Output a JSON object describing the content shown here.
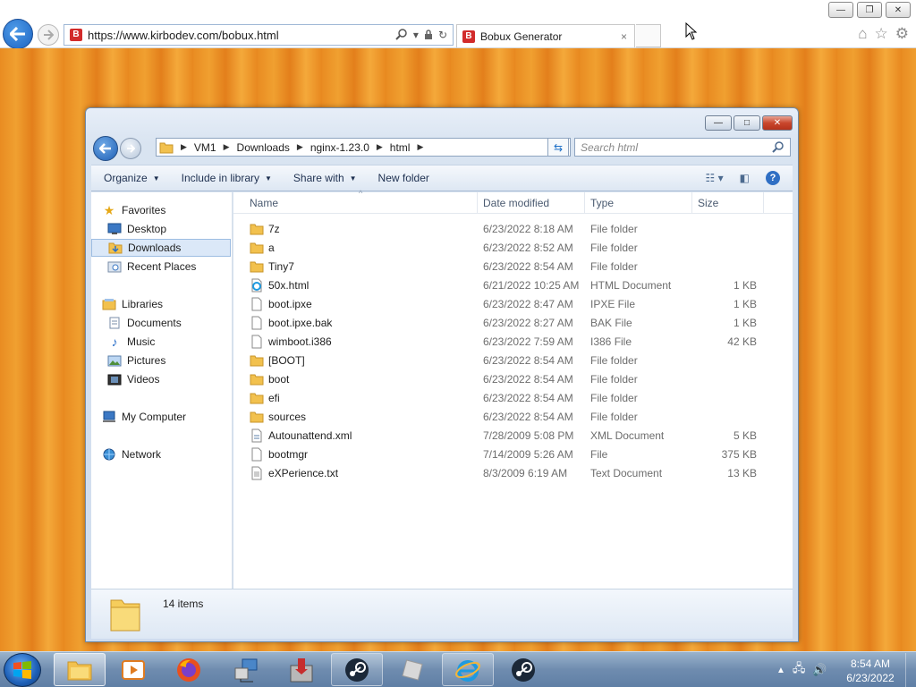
{
  "browser": {
    "url": "https://www.kirbodev.com/bobux.html",
    "tab_title": "Bobux Generator",
    "tab_close": "×",
    "site_badge": "B",
    "colors": {
      "badge": "#d22b2b",
      "back": "#1c64c2"
    }
  },
  "explorer": {
    "breadcrumb": [
      "VM1",
      "Downloads",
      "nginx-1.23.0",
      "html"
    ],
    "search_placeholder": "Search html",
    "commands": [
      "Organize",
      "Include in library",
      "Share with",
      "New folder"
    ],
    "nav": {
      "favorites": "Favorites",
      "fav_items": [
        "Desktop",
        "Downloads",
        "Recent Places"
      ],
      "libraries": "Libraries",
      "lib_items": [
        "Documents",
        "Music",
        "Pictures",
        "Videos"
      ],
      "computer": "My Computer",
      "network": "Network"
    },
    "columns": {
      "name": "Name",
      "date": "Date modified",
      "type": "Type",
      "size": "Size"
    },
    "files": [
      {
        "name": "7z",
        "date": "6/23/2022 8:18 AM",
        "type": "File folder",
        "size": "",
        "icon": "folder"
      },
      {
        "name": "a",
        "date": "6/23/2022 8:52 AM",
        "type": "File folder",
        "size": "",
        "icon": "folder"
      },
      {
        "name": "Tiny7",
        "date": "6/23/2022 8:54 AM",
        "type": "File folder",
        "size": "",
        "icon": "folder"
      },
      {
        "name": "50x.html",
        "date": "6/21/2022 10:25 AM",
        "type": "HTML Document",
        "size": "1 KB",
        "icon": "html"
      },
      {
        "name": "boot.ipxe",
        "date": "6/23/2022 8:47 AM",
        "type": "IPXE File",
        "size": "1 KB",
        "icon": "file"
      },
      {
        "name": "boot.ipxe.bak",
        "date": "6/23/2022 8:27 AM",
        "type": "BAK File",
        "size": "1 KB",
        "icon": "file"
      },
      {
        "name": "wimboot.i386",
        "date": "6/23/2022 7:59 AM",
        "type": "I386 File",
        "size": "42 KB",
        "icon": "file"
      },
      {
        "name": "[BOOT]",
        "date": "6/23/2022 8:54 AM",
        "type": "File folder",
        "size": "",
        "icon": "folder"
      },
      {
        "name": "boot",
        "date": "6/23/2022 8:54 AM",
        "type": "File folder",
        "size": "",
        "icon": "folder"
      },
      {
        "name": "efi",
        "date": "6/23/2022 8:54 AM",
        "type": "File folder",
        "size": "",
        "icon": "folder"
      },
      {
        "name": "sources",
        "date": "6/23/2022 8:54 AM",
        "type": "File folder",
        "size": "",
        "icon": "folder"
      },
      {
        "name": "Autounattend.xml",
        "date": "7/28/2009 5:08 PM",
        "type": "XML Document",
        "size": "5 KB",
        "icon": "xml"
      },
      {
        "name": "bootmgr",
        "date": "7/14/2009 5:26 AM",
        "type": "File",
        "size": "375 KB",
        "icon": "file"
      },
      {
        "name": "eXPerience.txt",
        "date": "8/3/2009 6:19 AM",
        "type": "Text Document",
        "size": "13 KB",
        "icon": "txt"
      }
    ],
    "item_count": "14 items"
  },
  "taskbar": {
    "time": "8:54 AM",
    "date": "6/23/2022",
    "apps": [
      "explorer-icon",
      "media-player-icon",
      "firefox-icon",
      "network-tool-icon",
      "installer-icon",
      "steam-icon",
      "roblox-icon",
      "internet-explorer-icon",
      "steam-icon"
    ]
  }
}
